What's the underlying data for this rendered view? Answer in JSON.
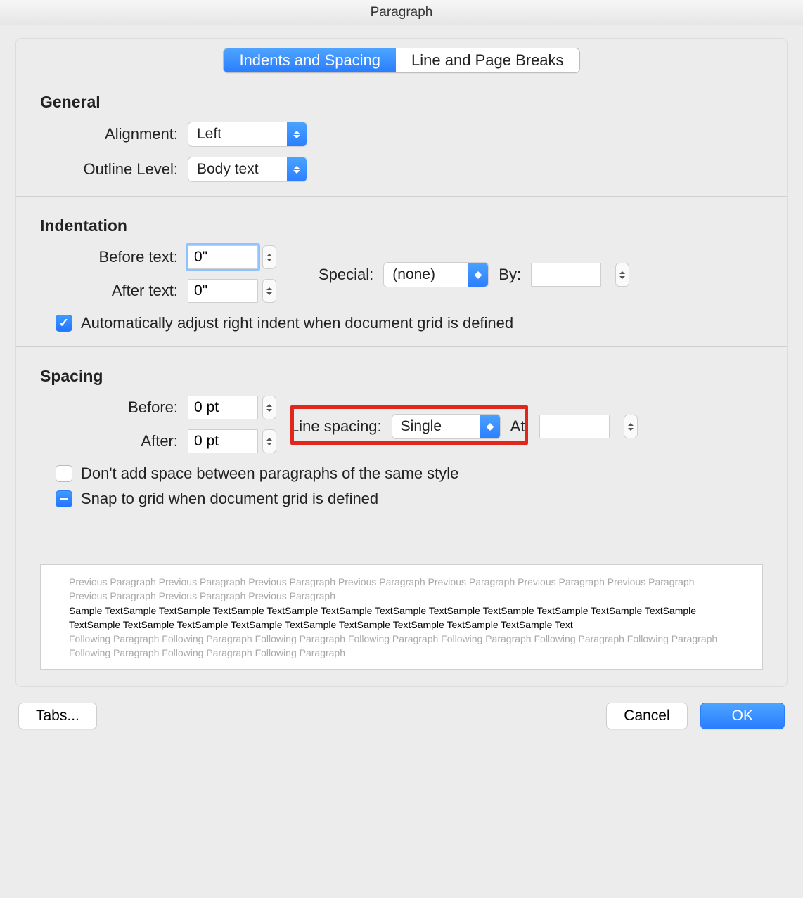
{
  "window": {
    "title": "Paragraph"
  },
  "tabs": {
    "indents": "Indents and Spacing",
    "breaks": "Line and Page Breaks"
  },
  "general": {
    "heading": "General",
    "alignment_label": "Alignment:",
    "alignment_value": "Left",
    "outline_label": "Outline Level:",
    "outline_value": "Body text"
  },
  "indentation": {
    "heading": "Indentation",
    "before_label": "Before text:",
    "before_value": "0\"",
    "after_label": "After text:",
    "after_value": "0\"",
    "special_label": "Special:",
    "special_value": "(none)",
    "by_label": "By:",
    "by_value": "",
    "autoindent_label": "Automatically adjust right indent when document grid is defined"
  },
  "spacing": {
    "heading": "Spacing",
    "before_label": "Before:",
    "before_value": "0 pt",
    "after_label": "After:",
    "after_value": "0 pt",
    "line_label": "Line spacing:",
    "line_value": "Single",
    "at_label": "At:",
    "at_value": "",
    "nospace_label": "Don't add space between paragraphs of the same style",
    "snap_label": "Snap to grid when document grid is defined"
  },
  "preview": {
    "prev": "Previous Paragraph Previous Paragraph Previous Paragraph Previous Paragraph Previous Paragraph Previous Paragraph Previous Paragraph Previous Paragraph Previous Paragraph Previous Paragraph",
    "sample": "Sample TextSample TextSample TextSample TextSample TextSample TextSample TextSample TextSample TextSample TextSample TextSample TextSample TextSample TextSample TextSample TextSample TextSample TextSample TextSample TextSample Text",
    "next": "Following Paragraph Following Paragraph Following Paragraph Following Paragraph Following Paragraph Following Paragraph Following Paragraph Following Paragraph Following Paragraph Following Paragraph"
  },
  "footer": {
    "tabs": "Tabs...",
    "cancel": "Cancel",
    "ok": "OK"
  }
}
